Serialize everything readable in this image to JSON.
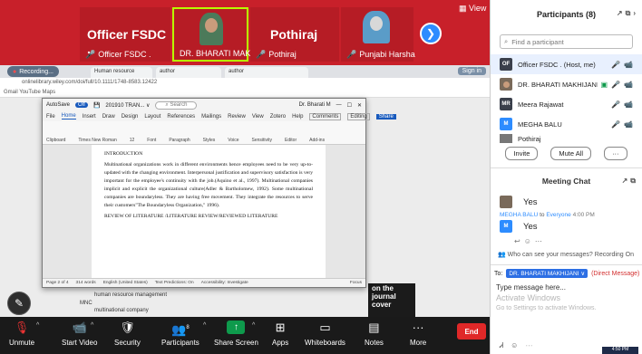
{
  "gallery": {
    "tiles": [
      {
        "display_name": "Officer FSDC .",
        "label": "Officer FSDC ."
      },
      {
        "label": "DR. BHARATI MAKHIJANI"
      },
      {
        "display_name": "Pothiraj",
        "label": "Pothiraj"
      },
      {
        "label": "Punjabi Harsha"
      }
    ],
    "view_label": "View"
  },
  "browser": {
    "recording_label": "Recording...",
    "tabs": [
      "Human resource",
      "author",
      "author"
    ],
    "sign_in": "Sign in",
    "address": "onlinelibrary.wiley.com/doi/full/10.1111/1748-8583.12422",
    "bookmarks": "Gmail   YouTube   Maps"
  },
  "word": {
    "autosave": "AutoSave",
    "autosave_state": "Off",
    "file_name": "201910 TRAN... ∨",
    "search_placeholder": "Search",
    "user": "Dr. Bharati M",
    "menu": [
      "File",
      "Home",
      "Insert",
      "Draw",
      "Design",
      "Layout",
      "References",
      "Mailings",
      "Review",
      "View",
      "Zotero",
      "Help"
    ],
    "comments": "Comments",
    "editing": "Editing",
    "share": "Share",
    "ribbon_groups": [
      "Clipboard",
      "Font",
      "Paragraph",
      "Styles",
      "Voice",
      "Sensitivity",
      "Editor",
      "Add-ins"
    ],
    "font": "Times New Roman",
    "font_size": "12",
    "heading": "INTRODUCTION",
    "paragraph": "Multinational organizations work in different environments hence employees need to be very up-to-updated with the changing environment. Interpersonal justification and supervisory satisfaction is very important for the employee's continuity with the job.(Aquino et al., 1997). Multinational companies implicit and explicit the organizational culture(Adler & Bartholomew, 1992). Some multinational companies are boundaryless. They are having free movement. They integrate the resources to serve their customers\"The Boundaryless Organization,\" 1996).",
    "lit_review": "REVIEW OF LITERATURE /LITERATURE REVIEW/REVIEWED LITERATURE",
    "status": [
      "Page 2 of 4",
      "314 words",
      "English (United States)",
      "Text Predictions: On",
      "Accessibility: Investigate"
    ],
    "focus": "Focus"
  },
  "background_page": {
    "lines": [
      "human resource management",
      "MNC",
      "multinational company"
    ],
    "journal": "on the journal cover"
  },
  "toolbar": {
    "items": [
      {
        "label": "Unmute",
        "icon": "microphone-muted-icon"
      },
      {
        "label": "Start Video",
        "icon": "video-off-icon"
      },
      {
        "label": "Security",
        "icon": "shield-icon"
      },
      {
        "label": "Participants",
        "icon": "participants-icon",
        "count": "8"
      },
      {
        "label": "Share Screen",
        "icon": "share-screen-icon"
      },
      {
        "label": "Apps",
        "icon": "apps-icon"
      },
      {
        "label": "Whiteboards",
        "icon": "whiteboard-icon"
      },
      {
        "label": "Notes",
        "icon": "notes-icon"
      },
      {
        "label": "More",
        "icon": "more-icon"
      }
    ],
    "end": "End"
  },
  "participants": {
    "title": "Participants (8)",
    "search_placeholder": "Find a participant",
    "list": [
      {
        "initials": "OF",
        "name": "Officer FSDC . (Host, me)",
        "color": "#3a3f4b"
      },
      {
        "initials": "",
        "name": "DR. BHARATI MAKHIJANI",
        "color": "#7a6a5a"
      },
      {
        "initials": "MR",
        "name": "Meera Rajawat",
        "color": "#3a3f4b"
      },
      {
        "initials": "M",
        "name": "MEGHA BALU",
        "color": "#2d8cff"
      },
      {
        "initials": "",
        "name": "Pothiraj",
        "color": "#777777"
      }
    ],
    "invite": "Invite",
    "mute_all": "Mute All",
    "more": "···"
  },
  "chat": {
    "title": "Meeting Chat",
    "msg1": "Yes",
    "sender": "MEGHA BALU",
    "to": "to",
    "recipient": "Everyone",
    "time": "4:00 PM",
    "msg2": "Yes",
    "who_can_see": "Who can see your messages? Recording On",
    "to_label": "To:",
    "to_target": "DR. BHARATI MAKHIJANI ∨",
    "direct": "(Direct Message)",
    "type_placeholder": "Type message here...",
    "watermark1": "Activate Windows",
    "watermark2": "Go to Settings to activate Windows.",
    "clock": "4:50 PM"
  }
}
